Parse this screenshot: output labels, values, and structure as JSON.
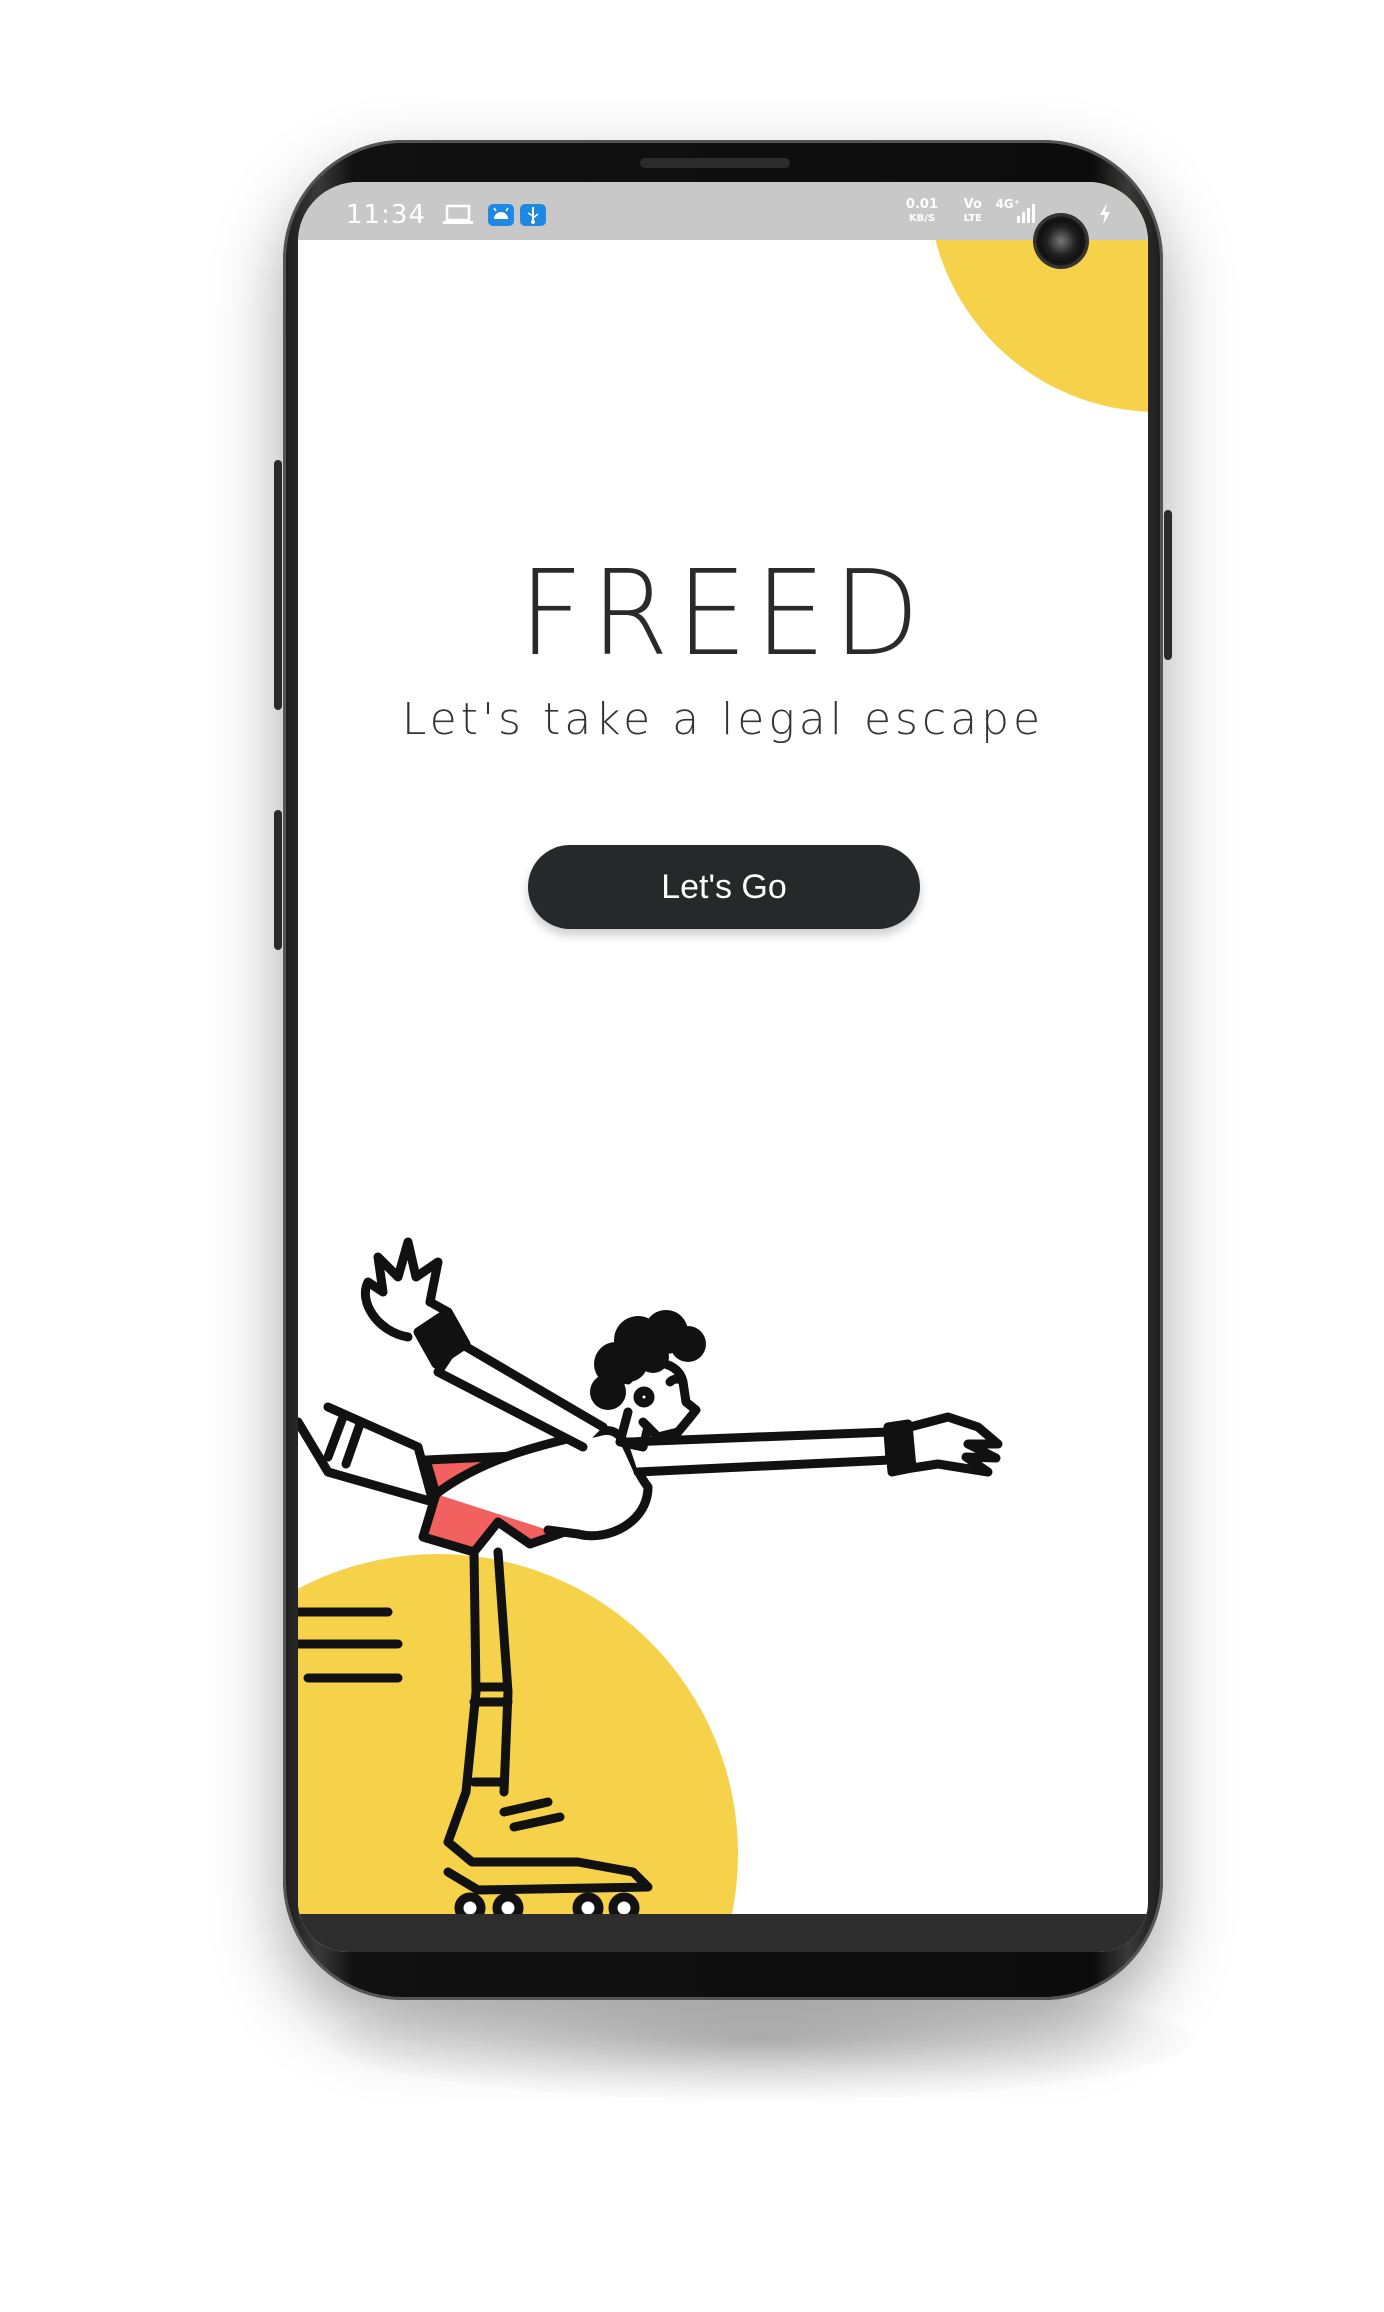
{
  "status_bar": {
    "time": "11:34",
    "speed_value": "0.01",
    "speed_unit": "KB/S",
    "volte_top": "Vo",
    "volte_bottom": "LTE",
    "network": "4G⁺",
    "icons": [
      "laptop-icon",
      "android-icon",
      "usb-icon",
      "signal-icon",
      "battery-charging-icon"
    ]
  },
  "splash": {
    "title": "FREED",
    "tagline": "Let's take a legal escape",
    "cta_label": "Let's Go"
  },
  "colors": {
    "accent_yellow": "#f6d24a",
    "button_dark": "#27282a",
    "shorts_red": "#f26060",
    "status_bar_bg": "#c8c8c8"
  },
  "illustration": "roller-skater-illustration"
}
